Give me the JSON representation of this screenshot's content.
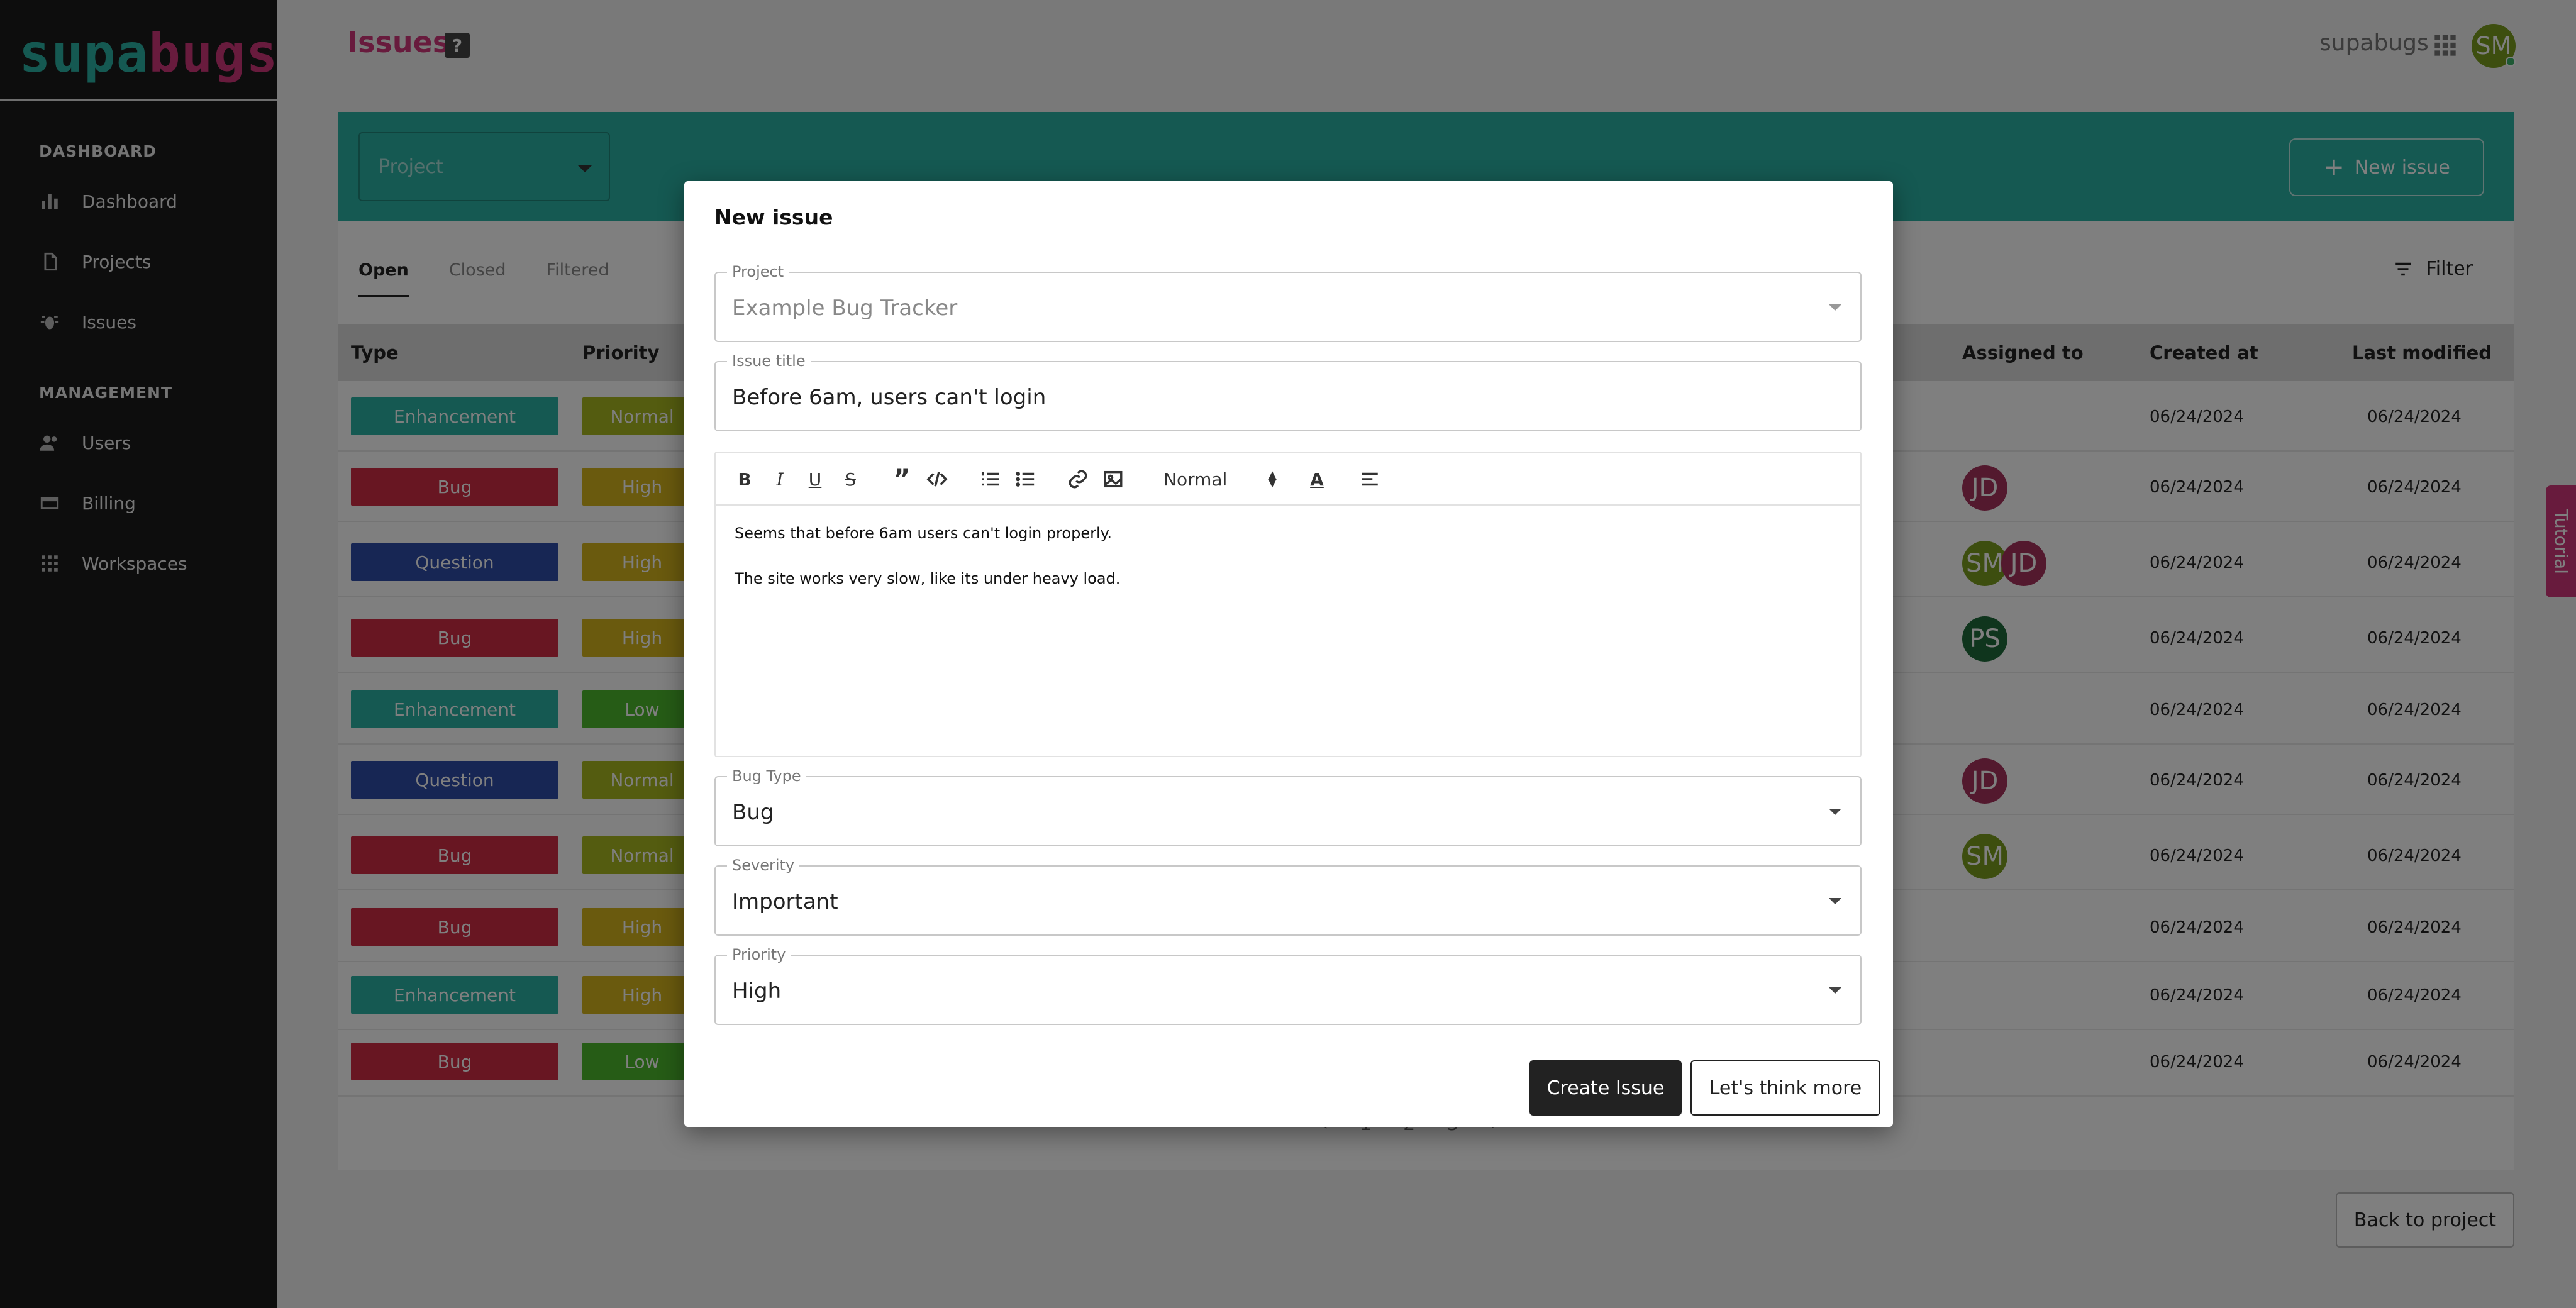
{
  "sidebar": {
    "logo_part1": "supa",
    "logo_part2": "bugs",
    "sections": [
      {
        "title": "DASHBOARD",
        "items": [
          {
            "label": "Dashboard",
            "icon": "bar-chart-icon"
          },
          {
            "label": "Projects",
            "icon": "document-icon"
          },
          {
            "label": "Issues",
            "icon": "bug-icon"
          }
        ]
      },
      {
        "title": "MANAGEMENT",
        "items": [
          {
            "label": "Users",
            "icon": "users-icon"
          },
          {
            "label": "Billing",
            "icon": "credit-card-icon"
          },
          {
            "label": "Workspaces",
            "icon": "grid-icon"
          }
        ]
      }
    ]
  },
  "header": {
    "title": "Issues",
    "help": "?",
    "brand": "supabugs",
    "avatar_initials": "SM"
  },
  "toolbar_panel": {
    "project_placeholder": "Project",
    "new_issue_label": "New issue"
  },
  "tabs": [
    "Open",
    "Closed",
    "Filtered"
  ],
  "filter_label": "Filter",
  "table": {
    "headers": {
      "type": "Type",
      "priority": "Priority",
      "assigned": "Assigned to",
      "created": "Created at",
      "modified": "Last modified"
    },
    "rows": [
      {
        "type": "Enhancement",
        "priority": "Normal",
        "assignees": [],
        "created": "06/24/2024",
        "modified": "06/24/2024"
      },
      {
        "type": "Bug",
        "priority": "High",
        "assignees": [
          "JD"
        ],
        "created": "06/24/2024",
        "modified": "06/24/2024"
      },
      {
        "type": "Question",
        "priority": "High",
        "assignees": [
          "SM",
          "JD"
        ],
        "created": "06/24/2024",
        "modified": "06/24/2024"
      },
      {
        "type": "Bug",
        "priority": "High",
        "assignees": [
          "PS"
        ],
        "created": "06/24/2024",
        "modified": "06/24/2024"
      },
      {
        "type": "Enhancement",
        "priority": "Low",
        "assignees": [],
        "created": "06/24/2024",
        "modified": "06/24/2024"
      },
      {
        "type": "Question",
        "priority": "Normal",
        "assignees": [
          "JD"
        ],
        "created": "06/24/2024",
        "modified": "06/24/2024"
      },
      {
        "type": "Bug",
        "priority": "Normal",
        "assignees": [
          "SM"
        ],
        "created": "06/24/2024",
        "modified": "06/24/2024"
      },
      {
        "type": "Bug",
        "priority": "High",
        "assignees": [],
        "created": "06/24/2024",
        "modified": "06/24/2024"
      },
      {
        "type": "Enhancement",
        "priority": "High",
        "assignees": [],
        "created": "06/24/2024",
        "modified": "06/24/2024"
      },
      {
        "type": "Bug",
        "priority": "Low",
        "assignees": [],
        "created": "06/24/2024",
        "modified": "06/24/2024"
      }
    ]
  },
  "pagination": {
    "pages": [
      "1",
      "2",
      "3"
    ],
    "prev": "‹",
    "next": "›"
  },
  "back_label": "Back to project",
  "tutorial_label": "Tutorial",
  "colors": {
    "teal": "#2bb3a4",
    "pink": "#d0367b",
    "type_enhancement": "#2bb3a4",
    "type_bug": "#d12c45",
    "type_question": "#2f4ca8",
    "prio_normal": "#a8b820",
    "prio_high": "#d4b41c",
    "prio_low": "#4cb82c",
    "avatar_JD": "#a7335c",
    "avatar_SM": "#7a9c1e",
    "avatar_PS": "#1f6a3a"
  },
  "modal": {
    "title": "New issue",
    "project": {
      "label": "Project",
      "value": "Example Bug Tracker"
    },
    "issue_title": {
      "label": "Issue title",
      "value": "Before 6am, users can't login"
    },
    "editor": {
      "heading_select": "Normal",
      "paragraphs": [
        "Seems that before 6am users can't login properly.",
        "The site works very slow, like its under heavy load."
      ]
    },
    "bug_type": {
      "label": "Bug Type",
      "value": "Bug"
    },
    "severity": {
      "label": "Severity",
      "value": "Important"
    },
    "priority": {
      "label": "Priority",
      "value": "High"
    },
    "create_label": "Create Issue",
    "think_label": "Let's think more"
  }
}
